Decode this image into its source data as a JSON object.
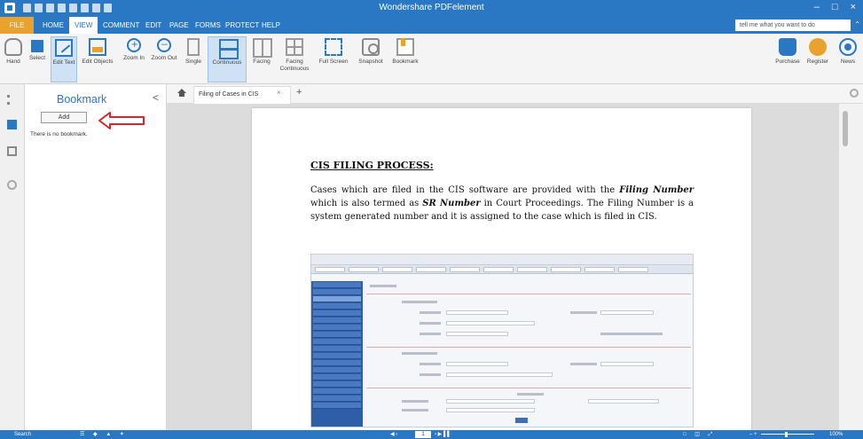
{
  "app": {
    "title": "Wondershare PDFelement",
    "window_controls": [
      "–",
      "□",
      "×"
    ]
  },
  "ribbon_tabs": [
    "FILE",
    "HOME",
    "VIEW",
    "COMMENT",
    "EDIT",
    "PAGE",
    "FORMS",
    "PROTECT",
    "HELP"
  ],
  "active_tab": "VIEW",
  "tell_me": {
    "placeholder": "tell me what you want to do"
  },
  "toolbar": {
    "hand": "Hand",
    "select": "Select",
    "edit_text": "Edit Text",
    "edit_objects": "Edit Objects",
    "zoom_in": "Zoom In",
    "zoom_out": "Zoom Out",
    "single": "Single",
    "continuous": "Continuous",
    "facing": "Facing",
    "facing_continuous": "Facing Continuous",
    "full_screen": "Full Screen",
    "snapshot": "Snapshot",
    "bookmark": "Bookmark",
    "purchase": "Purchase",
    "register": "Register",
    "news": "News"
  },
  "bookmark_panel": {
    "title": "Bookmark",
    "close": "<",
    "add_button": "Add",
    "empty_text": "There is no bookmark."
  },
  "document_tab": {
    "name": "Filing of Cases in CIS",
    "close": "×",
    "new": "+"
  },
  "document": {
    "heading": "CIS FILING PROCESS:",
    "p1_a": "Cases which are filed in the CIS software are provided with the ",
    "p1_b": "Filing Number",
    "p1_c": " which is also termed as ",
    "p1_d": "SR Number",
    "p1_e": " in Court Proceedings. The Filing Number is a system generated number and it is assigned to the case which is filed in CIS."
  },
  "statusbar": {
    "search": "Search",
    "page": "1",
    "page_prefix": "◀  ‹",
    "page_suffix": "›  ▶ ▌▌",
    "tools": "☰ ◆ ▲ ✦",
    "view_modes": "□ ◫ ⤢",
    "zoom_controls": "–            +",
    "zoom": "100%"
  },
  "colors": {
    "accent": "#2a77c4",
    "file_tab": "#e9a22d",
    "annotation_arrow": "#d9262c"
  }
}
